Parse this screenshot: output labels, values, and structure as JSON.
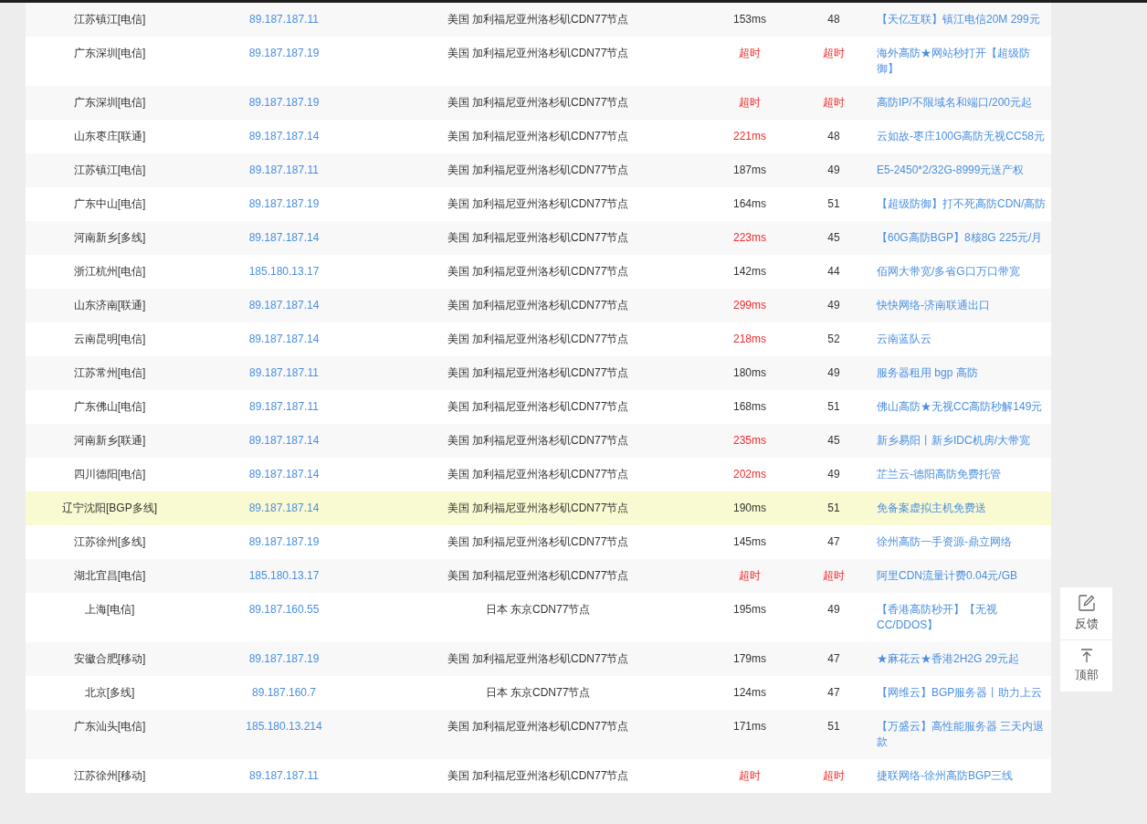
{
  "rows": [
    {
      "location": "江苏镇江[电信]",
      "ip": "89.187.187.11",
      "node": "美国 加利福尼亚州洛杉矶CDN77节点",
      "latency": "153ms",
      "latency_alert": false,
      "ttl": "48",
      "ttl_alert": false,
      "ad": "【天亿互联】镇江电信20M 299元",
      "highlighted": false
    },
    {
      "location": "广东深圳[电信]",
      "ip": "89.187.187.19",
      "node": "美国 加利福尼亚州洛杉矶CDN77节点",
      "latency": "超时",
      "latency_alert": true,
      "ttl": "超时",
      "ttl_alert": true,
      "ad": "海外高防★网站秒打开【超级防御】",
      "highlighted": false
    },
    {
      "location": "广东深圳[电信]",
      "ip": "89.187.187.19",
      "node": "美国 加利福尼亚州洛杉矶CDN77节点",
      "latency": "超时",
      "latency_alert": true,
      "ttl": "超时",
      "ttl_alert": true,
      "ad": "高防IP/不限域名和端口/200元起",
      "highlighted": false
    },
    {
      "location": "山东枣庄[联通]",
      "ip": "89.187.187.14",
      "node": "美国 加利福尼亚州洛杉矶CDN77节点",
      "latency": "221ms",
      "latency_alert": true,
      "ttl": "48",
      "ttl_alert": false,
      "ad": "云如故-枣庄100G高防无视CC58元",
      "highlighted": false
    },
    {
      "location": "江苏镇江[电信]",
      "ip": "89.187.187.11",
      "node": "美国 加利福尼亚州洛杉矶CDN77节点",
      "latency": "187ms",
      "latency_alert": false,
      "ttl": "49",
      "ttl_alert": false,
      "ad": "E5-2450*2/32G-8999元送产权",
      "highlighted": false
    },
    {
      "location": "广东中山[电信]",
      "ip": "89.187.187.19",
      "node": "美国 加利福尼亚州洛杉矶CDN77节点",
      "latency": "164ms",
      "latency_alert": false,
      "ttl": "51",
      "ttl_alert": false,
      "ad": "【超级防御】打不死高防CDN/高防",
      "highlighted": false
    },
    {
      "location": "河南新乡[多线]",
      "ip": "89.187.187.14",
      "node": "美国 加利福尼亚州洛杉矶CDN77节点",
      "latency": "223ms",
      "latency_alert": true,
      "ttl": "45",
      "ttl_alert": false,
      "ad": "【60G高防BGP】8核8G 225元/月",
      "highlighted": false
    },
    {
      "location": "浙江杭州[电信]",
      "ip": "185.180.13.17",
      "node": "美国 加利福尼亚州洛杉矶CDN77节点",
      "latency": "142ms",
      "latency_alert": false,
      "ttl": "44",
      "ttl_alert": false,
      "ad": "佰网大带宽/多省G口万口带宽",
      "highlighted": false
    },
    {
      "location": "山东济南[联通]",
      "ip": "89.187.187.14",
      "node": "美国 加利福尼亚州洛杉矶CDN77节点",
      "latency": "299ms",
      "latency_alert": true,
      "ttl": "49",
      "ttl_alert": false,
      "ad": "快快网络-济南联通出口",
      "highlighted": false
    },
    {
      "location": "云南昆明[电信]",
      "ip": "89.187.187.14",
      "node": "美国 加利福尼亚州洛杉矶CDN77节点",
      "latency": "218ms",
      "latency_alert": true,
      "ttl": "52",
      "ttl_alert": false,
      "ad": "云南蓝队云",
      "highlighted": false
    },
    {
      "location": "江苏常州[电信]",
      "ip": "89.187.187.11",
      "node": "美国 加利福尼亚州洛杉矶CDN77节点",
      "latency": "180ms",
      "latency_alert": false,
      "ttl": "49",
      "ttl_alert": false,
      "ad": "服务器租用 bgp 高防",
      "highlighted": false
    },
    {
      "location": "广东佛山[电信]",
      "ip": "89.187.187.11",
      "node": "美国 加利福尼亚州洛杉矶CDN77节点",
      "latency": "168ms",
      "latency_alert": false,
      "ttl": "51",
      "ttl_alert": false,
      "ad": "佛山高防★无视CC高防秒解149元",
      "highlighted": false
    },
    {
      "location": "河南新乡[联通]",
      "ip": "89.187.187.14",
      "node": "美国 加利福尼亚州洛杉矶CDN77节点",
      "latency": "235ms",
      "latency_alert": true,
      "ttl": "45",
      "ttl_alert": false,
      "ad": "新乡易阳丨新乡IDC机房/大带宽",
      "highlighted": false
    },
    {
      "location": "四川德阳[电信]",
      "ip": "89.187.187.14",
      "node": "美国 加利福尼亚州洛杉矶CDN77节点",
      "latency": "202ms",
      "latency_alert": true,
      "ttl": "49",
      "ttl_alert": false,
      "ad": "芷兰云-德阳高防免费托管",
      "highlighted": false
    },
    {
      "location": "辽宁沈阳[BGP多线]",
      "ip": "89.187.187.14",
      "node": "美国 加利福尼亚州洛杉矶CDN77节点",
      "latency": "190ms",
      "latency_alert": false,
      "ttl": "51",
      "ttl_alert": false,
      "ad": "免备案虚拟主机免费送",
      "highlighted": true
    },
    {
      "location": "江苏徐州[多线]",
      "ip": "89.187.187.19",
      "node": "美国 加利福尼亚州洛杉矶CDN77节点",
      "latency": "145ms",
      "latency_alert": false,
      "ttl": "47",
      "ttl_alert": false,
      "ad": "徐州高防一手资源-鼎立网络",
      "highlighted": false
    },
    {
      "location": "湖北宜昌[电信]",
      "ip": "185.180.13.17",
      "node": "美国 加利福尼亚州洛杉矶CDN77节点",
      "latency": "超时",
      "latency_alert": true,
      "ttl": "超时",
      "ttl_alert": true,
      "ad": "阿里CDN流量计费0.04元/GB",
      "highlighted": false
    },
    {
      "location": "上海[电信]",
      "ip": "89.187.160.55",
      "node": "日本 东京CDN77节点",
      "latency": "195ms",
      "latency_alert": false,
      "ttl": "49",
      "ttl_alert": false,
      "ad": "【香港高防秒开】【无视CC/DDOS】",
      "highlighted": false
    },
    {
      "location": "安徽合肥[移动]",
      "ip": "89.187.187.19",
      "node": "美国 加利福尼亚州洛杉矶CDN77节点",
      "latency": "179ms",
      "latency_alert": false,
      "ttl": "47",
      "ttl_alert": false,
      "ad": "★麻花云★香港2H2G 29元起",
      "highlighted": false
    },
    {
      "location": "北京[多线]",
      "ip": "89.187.160.7",
      "node": "日本 东京CDN77节点",
      "latency": "124ms",
      "latency_alert": false,
      "ttl": "47",
      "ttl_alert": false,
      "ad": "【网维云】BGP服务器丨助力上云",
      "highlighted": false
    },
    {
      "location": "广东汕头[电信]",
      "ip": "185.180.13.214",
      "node": "美国 加利福尼亚州洛杉矶CDN77节点",
      "latency": "171ms",
      "latency_alert": false,
      "ttl": "51",
      "ttl_alert": false,
      "ad": "【万盛云】高性能服务器 三天内退款",
      "highlighted": false
    },
    {
      "location": "江苏徐州[移动]",
      "ip": "89.187.187.11",
      "node": "美国 加利福尼亚州洛杉矶CDN77节点",
      "latency": "超时",
      "latency_alert": true,
      "ttl": "超时",
      "ttl_alert": true,
      "ad": "捷联网络-徐州高防BGP三线",
      "highlighted": false
    }
  ],
  "float_buttons": [
    {
      "kind": "feedback",
      "label": "反馈"
    },
    {
      "kind": "top",
      "label": "顶部"
    }
  ]
}
